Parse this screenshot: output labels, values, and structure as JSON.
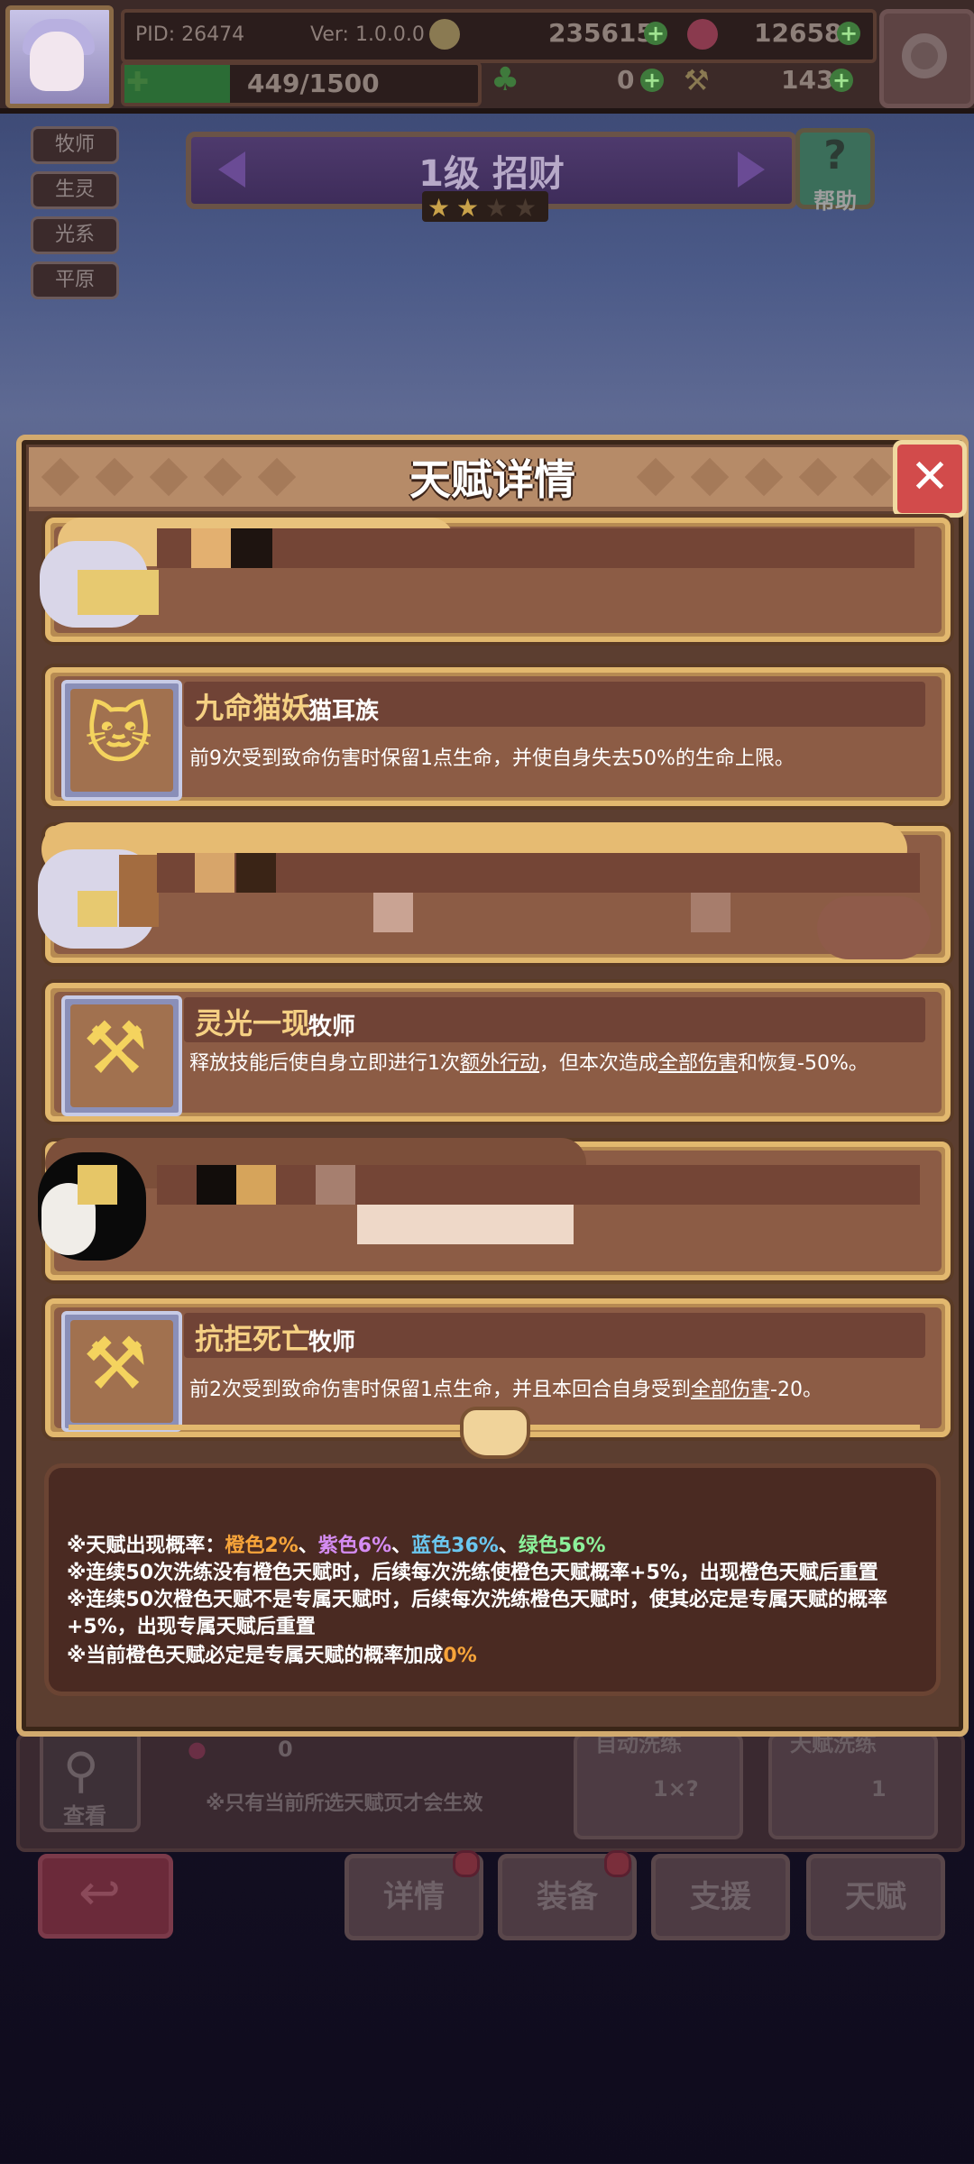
{
  "topbar": {
    "pid": "PID: 26474",
    "version": "Ver: 1.0.0.0",
    "gold": "235615",
    "gems": "12658",
    "clover": "0",
    "hammer": "143",
    "stamina": "449/1500",
    "stamina_progress": 0.299
  },
  "tags": [
    "牧师",
    "生灵",
    "光系",
    "平原"
  ],
  "banner": {
    "title": "1级  招财",
    "help_label": "帮助",
    "help_symbol": "?"
  },
  "stars": {
    "filled": 2,
    "total": 4
  },
  "modal": {
    "title": "天赋详情",
    "close_symbol": "✕"
  },
  "talents": [
    {
      "name": "九命猫妖",
      "type": "猫耳族",
      "desc": "前9次受到致命伤害时保留1点生命，并使自身失去50%的生命上限。",
      "icon": "cat-face-icon"
    },
    {
      "name": "灵光一现",
      "type": "牧师",
      "desc_parts": [
        "释放技能后使自身立即进行1次",
        "额外行动",
        "，但本次造成",
        "全部伤害",
        "和恢复-50%。"
      ],
      "icon": "hammer-icon"
    },
    {
      "name": "抗拒死亡",
      "type": "牧师",
      "desc_parts": [
        "前2次受到致命伤害时保留1点生命，并且本回合自身受到",
        "全部伤害",
        "-20。"
      ],
      "icon": "hammer-icon"
    }
  ],
  "info": {
    "line1_prefix": "※天赋出现概率：",
    "orange": "橙色2%",
    "sep1": "、",
    "purple": "紫色6%",
    "sep2": "、",
    "blue": "蓝色36%",
    "sep3": "、",
    "green": "绿色56%",
    "line2": "※连续50次洗练没有橙色天赋时，后续每次洗练使橙色天赋概率+5%，出现橙色天赋后重置",
    "line3a": "※连续50次橙色天赋不是专属天赋时，后续每次洗练橙色天赋时，使其必定是专属天赋的概率",
    "line3b": "+5%，出现专属天赋后重置",
    "line4_prefix": "※当前橙色天赋必定是专属天赋的概率加成",
    "line4_value": "0%"
  },
  "lower": {
    "search_label": "查看",
    "count": "0",
    "notice": "※只有当前所选天赋页才会生效",
    "auto_label": "自动洗练",
    "auto_value": "1×?",
    "talent_wash_label": "天赋洗练",
    "talent_wash_value": "1"
  },
  "tabs": [
    "详情",
    "装备",
    "支援",
    "天赋"
  ],
  "colors": {
    "gold_text": "#f5d083",
    "modal_bg": "#5c3e30",
    "card_border": "#e2b86e",
    "close_red": "#d24b4b"
  }
}
